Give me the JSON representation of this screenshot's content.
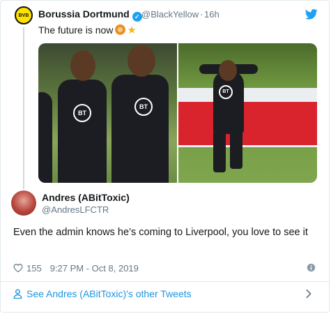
{
  "parent_tweet": {
    "author_name": "Borussia Dortmund",
    "handle": "@BlackYellow",
    "separator": "·",
    "time": "16h",
    "text": "The future is now",
    "logo_text": "BVB",
    "shirt_logo_text": "BT"
  },
  "reply_tweet": {
    "author_name": "Andres (ABitToxic)",
    "handle": "@AndresLFCTR",
    "text": "Even the admin knows he’s coming to Liverpool, you love to see it",
    "likes": "155",
    "timestamp": "9:27 PM - Oct 8, 2019"
  },
  "footer": {
    "see_more_label": "See Andres (ABitToxic)'s other Tweets"
  },
  "colors": {
    "link_blue": "#1b95e0",
    "twitter_blue": "#1da1f2",
    "muted_text": "#657786",
    "bvb_yellow": "#fde100"
  },
  "icons": {
    "verified": "verified-badge-icon",
    "bird": "twitter-bird-icon",
    "heart": "heart-icon",
    "info": "info-icon",
    "person": "person-icon",
    "chevron": "chevron-right-icon"
  }
}
